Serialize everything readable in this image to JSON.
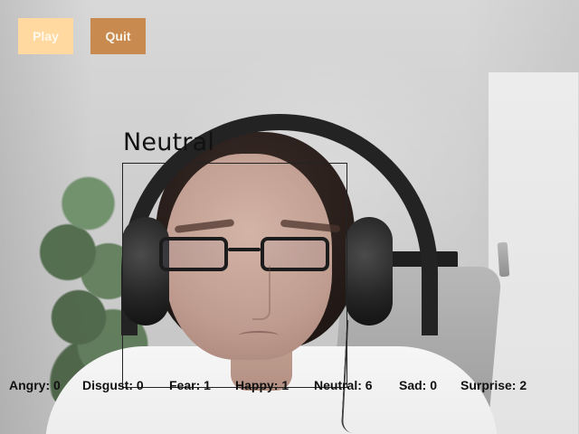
{
  "controls": {
    "play_label": "Play",
    "quit_label": "Quit"
  },
  "detection": {
    "label": "Neutral"
  },
  "stats": [
    "Angry: 0",
    "Disgust: 0",
    "Fear: 1",
    "Happy: 1",
    "Neutral: 6",
    "Sad: 0",
    "Surprise: 2"
  ],
  "colors": {
    "play_button": "#ffd9a0",
    "quit_button": "#c98a4f",
    "box": "#232323",
    "text": "#111111"
  }
}
